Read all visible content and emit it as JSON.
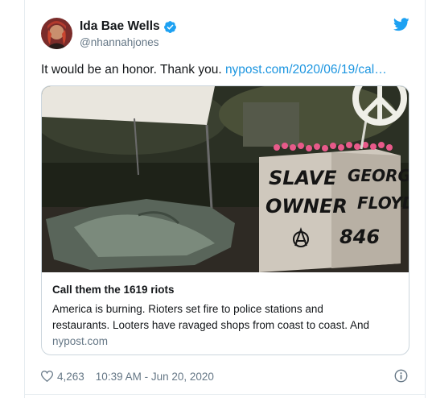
{
  "author": {
    "name": "Ida Bae Wells",
    "handle": "@nhannahjones",
    "verified": true,
    "avatar_icon": "avatar-photo"
  },
  "tweet": {
    "text": "It would be an honor. Thank you. ",
    "link_text": "nypost.com/2020/06/19/cal…"
  },
  "card": {
    "title": "Call them the 1619 riots",
    "description_line1": "America is burning. Rioters set fire to police stations and",
    "description_line2": "restaurants. Looters have ravaged shops from coast to coast. And",
    "domain": "nypost.com",
    "image_text": {
      "left_line1": "SLAVE",
      "left_line2": "OWNER",
      "right_line1": "GEORGE",
      "right_line2": "FLOYD",
      "right_line3": "846"
    }
  },
  "footer": {
    "likes": "4,263",
    "timestamp": "10:39 AM - Jun 20, 2020"
  },
  "colors": {
    "link": "#1b95e0",
    "twitter_blue": "#1da1f2",
    "secondary_text": "#657786",
    "border": "#ccd6dd"
  }
}
